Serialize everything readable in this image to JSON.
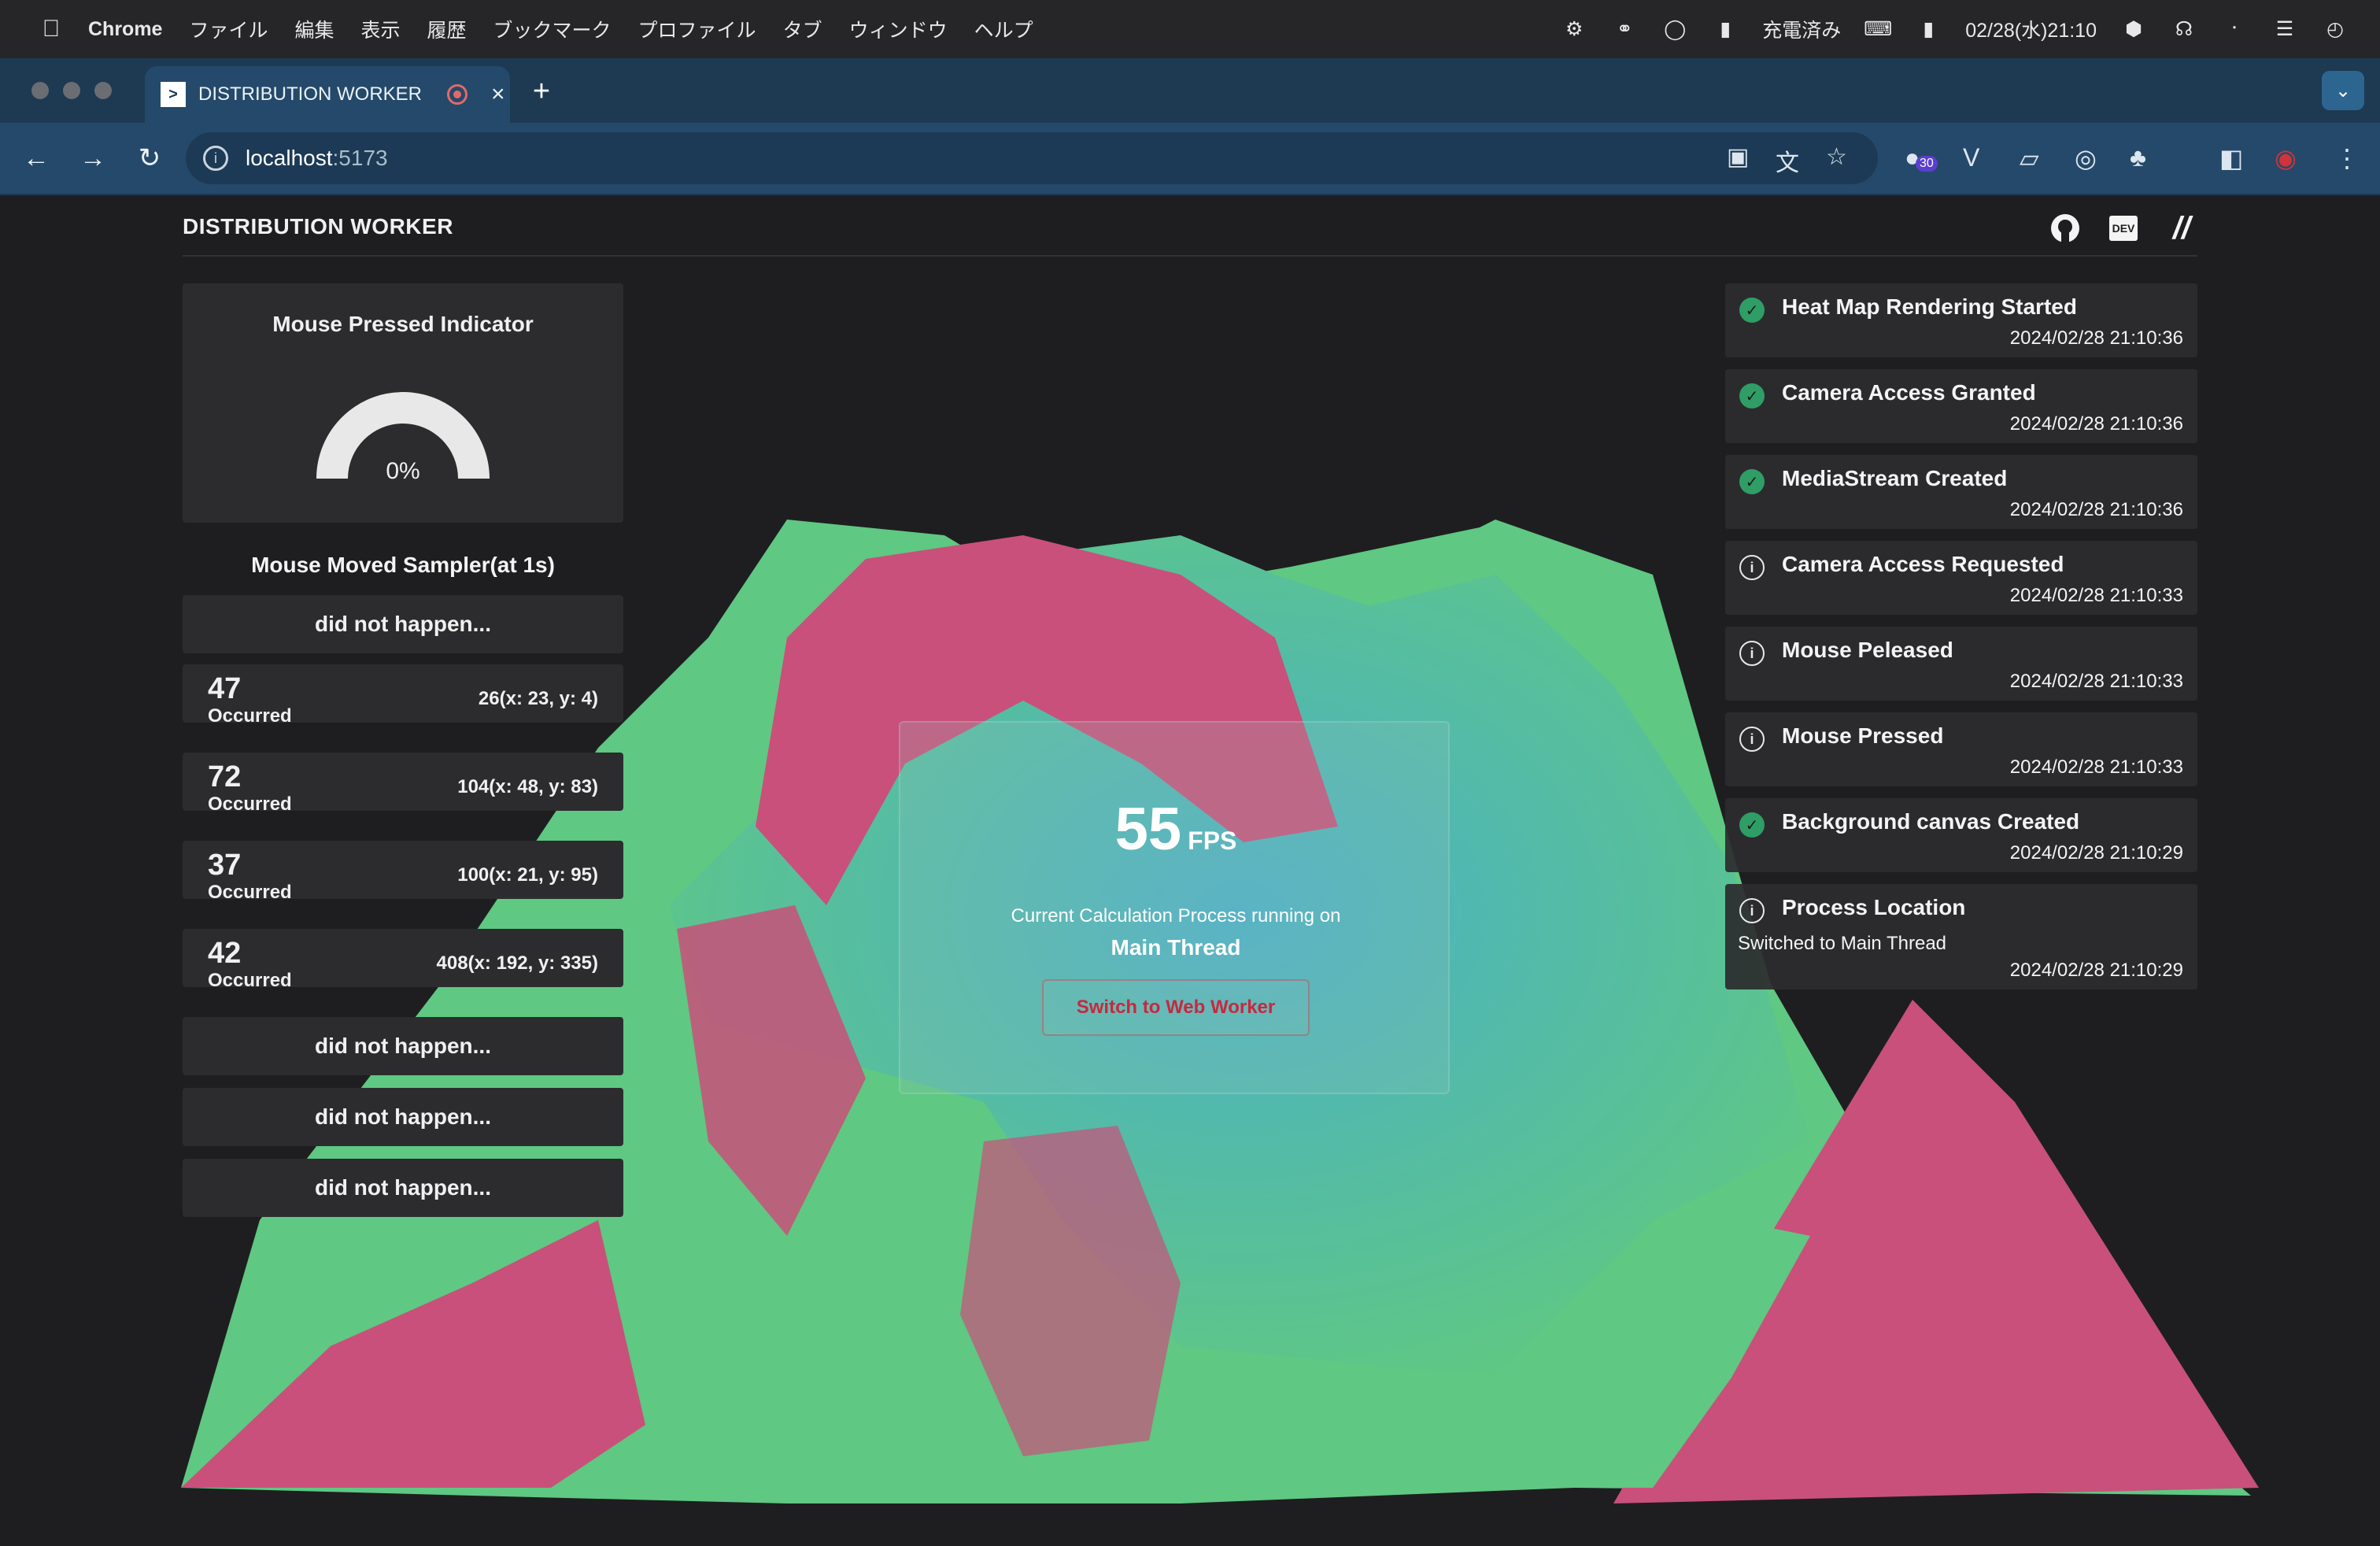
{
  "menubar": {
    "app": "Chrome",
    "items": [
      "ファイル",
      "編集",
      "表示",
      "履歴",
      "ブックマーク",
      "プロファイル",
      "タブ",
      "ウィンドウ",
      "ヘルプ"
    ],
    "charge_status": "充電済み",
    "datetime": "02/28(水)21:10"
  },
  "browser": {
    "tab_title": "DISTRIBUTION WORKER",
    "tab_favicon": ">",
    "url_host": "localhost",
    "url_port": ":5173",
    "extension_badge": "30"
  },
  "app": {
    "title": "DISTRIBUTION WORKER",
    "header_icons": [
      "github-icon",
      "dev-icon",
      "zenn-icon"
    ],
    "dev_icon_text": "DEV"
  },
  "mouse_pressed": {
    "title": "Mouse Pressed Indicator",
    "percent_label": "0%",
    "percent_value": 0
  },
  "sampler": {
    "title": "Mouse Moved Sampler(at 1s)",
    "rows": [
      {
        "empty": "did not happen..."
      },
      {
        "count": "47",
        "label": "Occurred",
        "value": "26(x: 23, y: 4)"
      },
      {
        "count": "72",
        "label": "Occurred",
        "value": "104(x: 48, y: 83)"
      },
      {
        "count": "37",
        "label": "Occurred",
        "value": "100(x: 21, y: 95)"
      },
      {
        "count": "42",
        "label": "Occurred",
        "value": "408(x: 192, y: 335)"
      },
      {
        "empty": "did not happen..."
      },
      {
        "empty": "did not happen..."
      },
      {
        "empty": "did not happen..."
      }
    ]
  },
  "fps_panel": {
    "fps": "55",
    "fps_unit": "FPS",
    "caption": "Current Calculation Process running on",
    "thread": "Main Thread",
    "button": "Switch to Web Worker"
  },
  "notifications": [
    {
      "type": "success",
      "title": "Heat Map Rendering Started",
      "time": "2024/02/28 21:10:36"
    },
    {
      "type": "success",
      "title": "Camera Access Granted",
      "time": "2024/02/28 21:10:36"
    },
    {
      "type": "success",
      "title": "MediaStream Created",
      "time": "2024/02/28 21:10:36"
    },
    {
      "type": "info",
      "title": "Camera Access Requested",
      "time": "2024/02/28 21:10:33"
    },
    {
      "type": "info",
      "title": "Mouse Peleased",
      "time": "2024/02/28 21:10:33"
    },
    {
      "type": "info",
      "title": "Mouse Pressed",
      "time": "2024/02/28 21:10:33"
    },
    {
      "type": "success",
      "title": "Background canvas Created",
      "time": "2024/02/28 21:10:29"
    },
    {
      "type": "info",
      "title": "Process Location",
      "subtitle": "Switched to Main Thread",
      "time": "2024/02/28 21:10:29"
    }
  ],
  "colors": {
    "heat_pink": "#c9507a",
    "heat_green": "#5fc882",
    "heat_blue": "#4ab0c8",
    "success": "#2e9e66"
  }
}
